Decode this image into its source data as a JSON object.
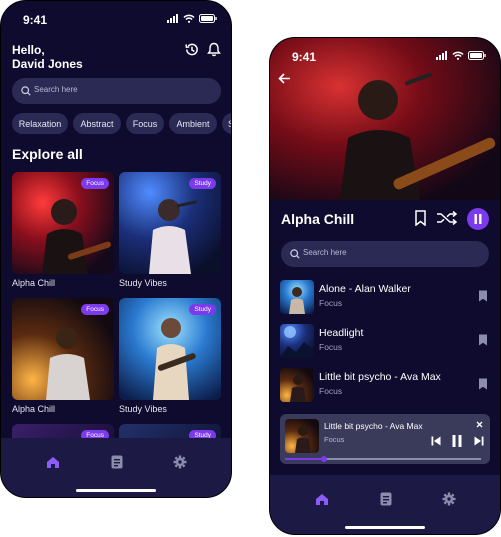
{
  "status": {
    "time": "9:41"
  },
  "home": {
    "greeting": "Hello,",
    "user_name": "David Jones",
    "search_placeholder": "Search here",
    "chips": [
      "Relaxation",
      "Abstract",
      "Focus",
      "Ambient",
      "S"
    ],
    "section_title": "Explore all",
    "cards": [
      {
        "title": "Alpha Chill",
        "badge": "Focus"
      },
      {
        "title": "Study Vibes",
        "badge": "Study"
      },
      {
        "title": "Alpha Chill",
        "badge": "Focus"
      },
      {
        "title": "Study Vibes",
        "badge": "Study"
      },
      {
        "title": "",
        "badge": "Focus"
      },
      {
        "title": "",
        "badge": "Study"
      }
    ]
  },
  "player": {
    "playlist_title": "Alpha Chill",
    "search_placeholder": "Search here",
    "songs": [
      {
        "title": "Alone - Alan Walker",
        "tag": "Focus"
      },
      {
        "title": "Headlight",
        "tag": "Focus"
      },
      {
        "title": "Little bit psycho - Ava Max",
        "tag": "Focus"
      }
    ],
    "mini": {
      "title": "Little bit psycho - Ava Max",
      "tag": "Focus",
      "progress": 0.2
    }
  },
  "colors": {
    "background": "#0f0b2e",
    "surface": "#2b2a55",
    "nav": "#1c1a44",
    "accent": "#7c3aed"
  },
  "icons": [
    "signal-icon",
    "wifi-icon",
    "battery-icon",
    "history-icon",
    "bell-icon",
    "search-icon",
    "home-icon",
    "library-icon",
    "settings-icon",
    "back-arrow-icon",
    "bookmark-icon",
    "shuffle-icon",
    "pause-icon",
    "close-icon",
    "previous-icon",
    "next-icon"
  ]
}
